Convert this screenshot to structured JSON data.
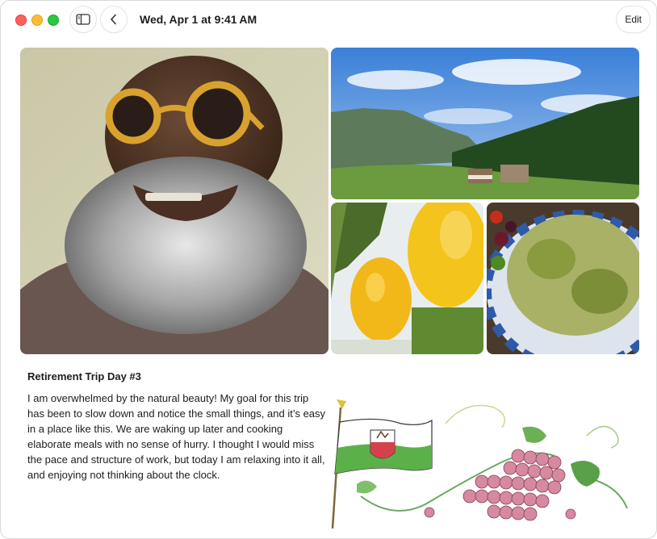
{
  "window": {
    "title": "Wed, Apr 1 at 9:41 AM",
    "edit_label": "Edit"
  },
  "icons": {
    "close": "close-icon",
    "minimize": "minimize-icon",
    "zoom": "zoom-icon",
    "sidebar": "sidebar-icon",
    "back": "chevron-left-icon"
  },
  "photos": [
    {
      "name": "portrait-photo",
      "subject": "man-with-sunglasses"
    },
    {
      "name": "mountain-valley-photo",
      "subject": "alpine-valley"
    },
    {
      "name": "lemons-photo",
      "subject": "lemons-on-tree"
    },
    {
      "name": "pasta-photo",
      "subject": "pesto-pasta"
    }
  ],
  "entry": {
    "title": "Retirement Trip Day #3",
    "body": "I am overwhelmed by the natural beauty! My goal for this trip has been to slow down and notice the small things, and it’s easy in a place like this. We are waking up later and cooking elaborate meals with no sense of hurry. I thought I would miss the pace and structure of work, but today I am relaxing into it all, and enjoying not thinking about the clock."
  },
  "colors": {
    "close": "#ff5f57",
    "minimize": "#febc2e",
    "zoom": "#28c840",
    "text": "#1d1d1f"
  }
}
